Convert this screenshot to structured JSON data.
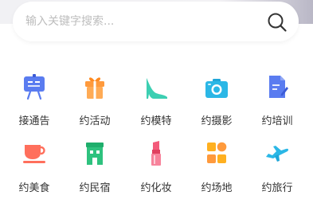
{
  "search": {
    "placeholder": "输入关键字搜索..."
  },
  "categories": [
    {
      "label": "接通告",
      "icon": "billboard-icon"
    },
    {
      "label": "约活动",
      "icon": "gift-icon"
    },
    {
      "label": "约模特",
      "icon": "high-heel-icon"
    },
    {
      "label": "约摄影",
      "icon": "camera-icon"
    },
    {
      "label": "约培训",
      "icon": "document-pen-icon"
    },
    {
      "label": "约美食",
      "icon": "coffee-cup-icon"
    },
    {
      "label": "约民宿",
      "icon": "house-icon"
    },
    {
      "label": "约化妆",
      "icon": "lipstick-icon"
    },
    {
      "label": "约场地",
      "icon": "venue-grid-icon"
    },
    {
      "label": "约旅行",
      "icon": "airplane-icon"
    }
  ],
  "colors": {
    "blue": "#5a7cf0",
    "orange": "#ff9a3c",
    "teal": "#3ccfb2",
    "cyan": "#2bb7e6",
    "coral": "#ff6f5c",
    "green": "#2ec27e",
    "pink": "#f35b7a",
    "amber": "#ffb020"
  }
}
